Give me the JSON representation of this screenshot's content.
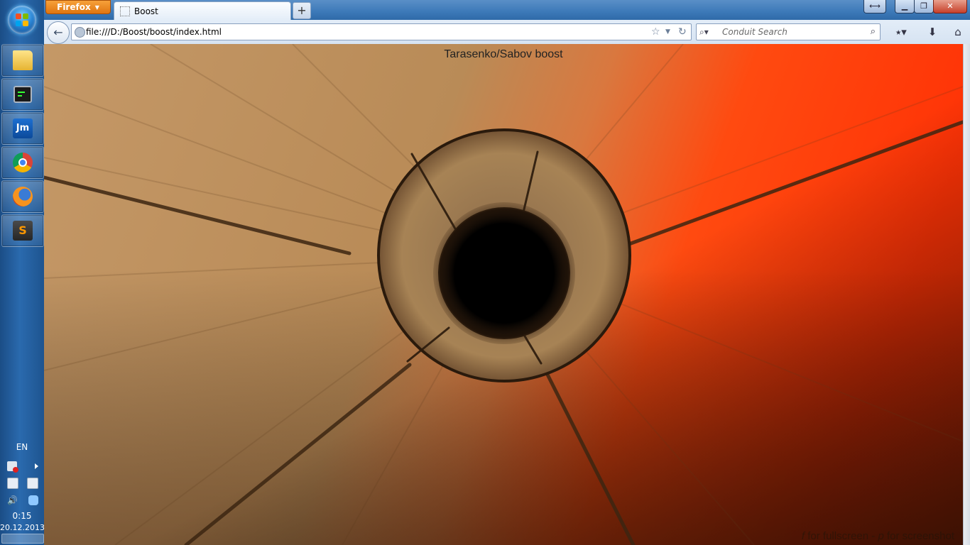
{
  "taskbar": {
    "pinned": [
      {
        "name": "file-explorer"
      },
      {
        "name": "terminal"
      },
      {
        "name": "jetbrains"
      },
      {
        "name": "chrome"
      },
      {
        "name": "firefox"
      },
      {
        "name": "sublime-text"
      }
    ],
    "language": "EN",
    "clock": {
      "time": "0:15",
      "date": "20.12.2013"
    }
  },
  "browser": {
    "menu_label": "Firefox",
    "tab_title": "Boost",
    "new_tab_label": "+",
    "url": "file:///D:/Boost/boost/index.html",
    "search_placeholder": "Conduit Search"
  },
  "page": {
    "title": "Tarasenko/Sabov boost",
    "hint": {
      "key_f": "f",
      "text_f": " for fullscreen - ",
      "key_p": "p",
      "text_p": " for screenshot"
    }
  },
  "colors": {
    "wood": "#b98b57",
    "wood_dark": "#6e4a2a",
    "glow_orange": "#ff3a06",
    "taskbar": "#1e548f",
    "firefox_orange": "#e8811c"
  }
}
